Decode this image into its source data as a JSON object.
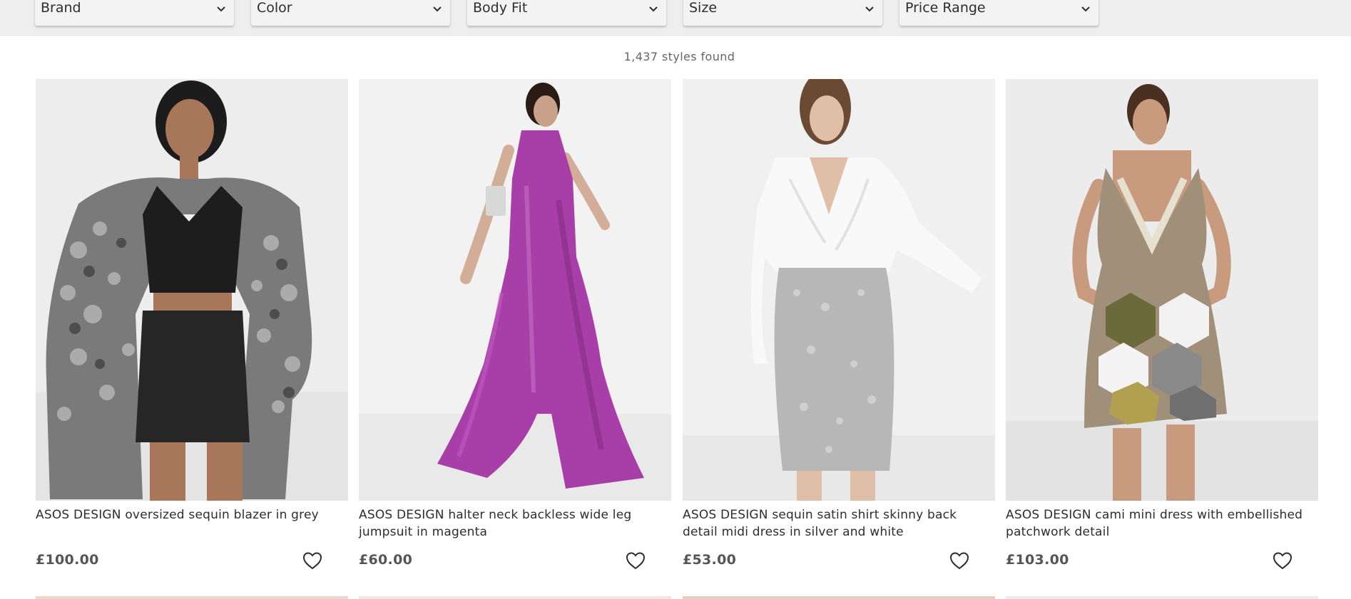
{
  "filters": [
    {
      "label": "Brand",
      "icon": "chevron-down-icon"
    },
    {
      "label": "Color",
      "icon": "chevron-down-icon"
    },
    {
      "label": "Body Fit",
      "icon": "chevron-down-icon"
    },
    {
      "label": "Size",
      "icon": "chevron-down-icon"
    },
    {
      "label": "Price Range",
      "icon": "chevron-down-icon"
    }
  ],
  "results": {
    "count_text": "1,437 styles found"
  },
  "products": [
    {
      "title": "ASOS DESIGN oversized sequin blazer in grey",
      "price": "£100.00",
      "wishlist_icon": "heart-icon"
    },
    {
      "title": "ASOS DESIGN halter neck backless wide leg jumpsuit in magenta",
      "price": "£60.00",
      "wishlist_icon": "heart-icon"
    },
    {
      "title": "ASOS DESIGN sequin satin shirt skinny back detail midi dress in silver and white",
      "price": "£53.00",
      "wishlist_icon": "heart-icon"
    },
    {
      "title": "ASOS DESIGN cami mini dress with embellished patchwork detail",
      "price": "£103.00",
      "wishlist_icon": "heart-icon"
    }
  ],
  "colors": {
    "filter_bar_bg": "#eeeeee",
    "text": "#2d2d2d",
    "price": "#555555",
    "muted": "#666666"
  }
}
